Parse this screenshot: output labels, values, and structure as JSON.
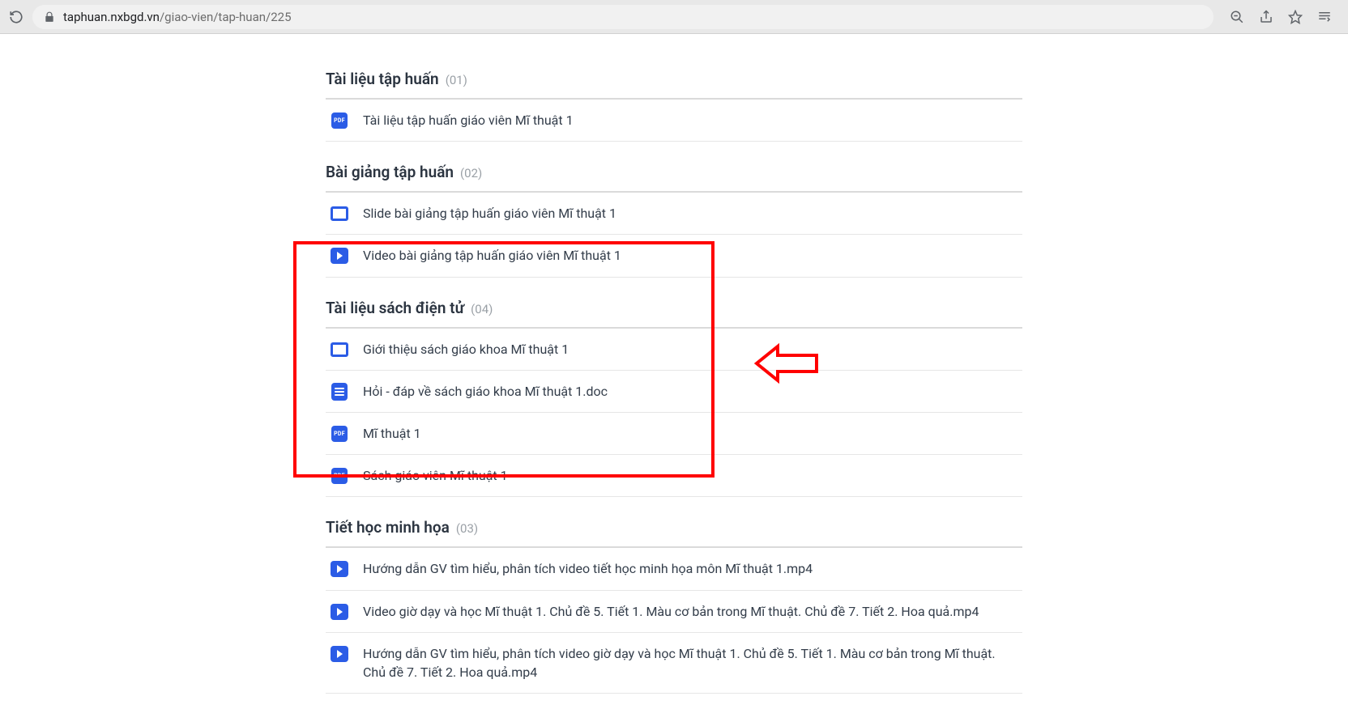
{
  "browser": {
    "url_host": "taphuan.nxbgd.vn",
    "url_path": "/giao-vien/tap-huan/225"
  },
  "sections": [
    {
      "title": "Tài liệu tập huấn",
      "count": "(01)",
      "items": [
        {
          "icon": "pdf",
          "label": "Tài liệu tập huấn giáo viên Mĩ thuật 1"
        }
      ]
    },
    {
      "title": "Bài giảng tập huấn",
      "count": "(02)",
      "items": [
        {
          "icon": "slide",
          "label": "Slide bài giảng tập huấn giáo viên Mĩ thuật 1"
        },
        {
          "icon": "video",
          "label": "Video bài giảng tập huấn giáo viên Mĩ thuật 1"
        }
      ]
    },
    {
      "title": "Tài liệu sách điện tử",
      "count": "(04)",
      "items": [
        {
          "icon": "slide",
          "label": "Giới thiệu sách giáo khoa Mĩ thuật 1"
        },
        {
          "icon": "doc",
          "label": "Hỏi - đáp về sách giáo khoa Mĩ thuật 1.doc"
        },
        {
          "icon": "pdf",
          "label": "Mĩ thuật 1"
        },
        {
          "icon": "pdf",
          "label": "Sách giáo viên Mĩ thuật 1"
        }
      ]
    },
    {
      "title": "Tiết học minh họa",
      "count": "(03)",
      "items": [
        {
          "icon": "video",
          "label": "Hướng dẫn GV tìm hiểu, phân tích video tiết học minh họa môn Mĩ thuật 1.mp4"
        },
        {
          "icon": "video",
          "label": "Video giờ dạy và học Mĩ thuật 1. Chủ đề 5. Tiết 1. Màu cơ bản trong Mĩ thuật. Chủ đề 7. Tiết 2. Hoa quả.mp4"
        },
        {
          "icon": "video",
          "label": "Hướng dẫn GV tìm hiểu, phân tích video giờ dạy và học Mĩ thuật 1. Chủ đề 5. Tiết 1. Màu cơ bản trong Mĩ thuật. Chủ đề 7. Tiết 2. Hoa quả.mp4"
        }
      ]
    }
  ],
  "icon_labels": {
    "pdf": "PDF"
  }
}
